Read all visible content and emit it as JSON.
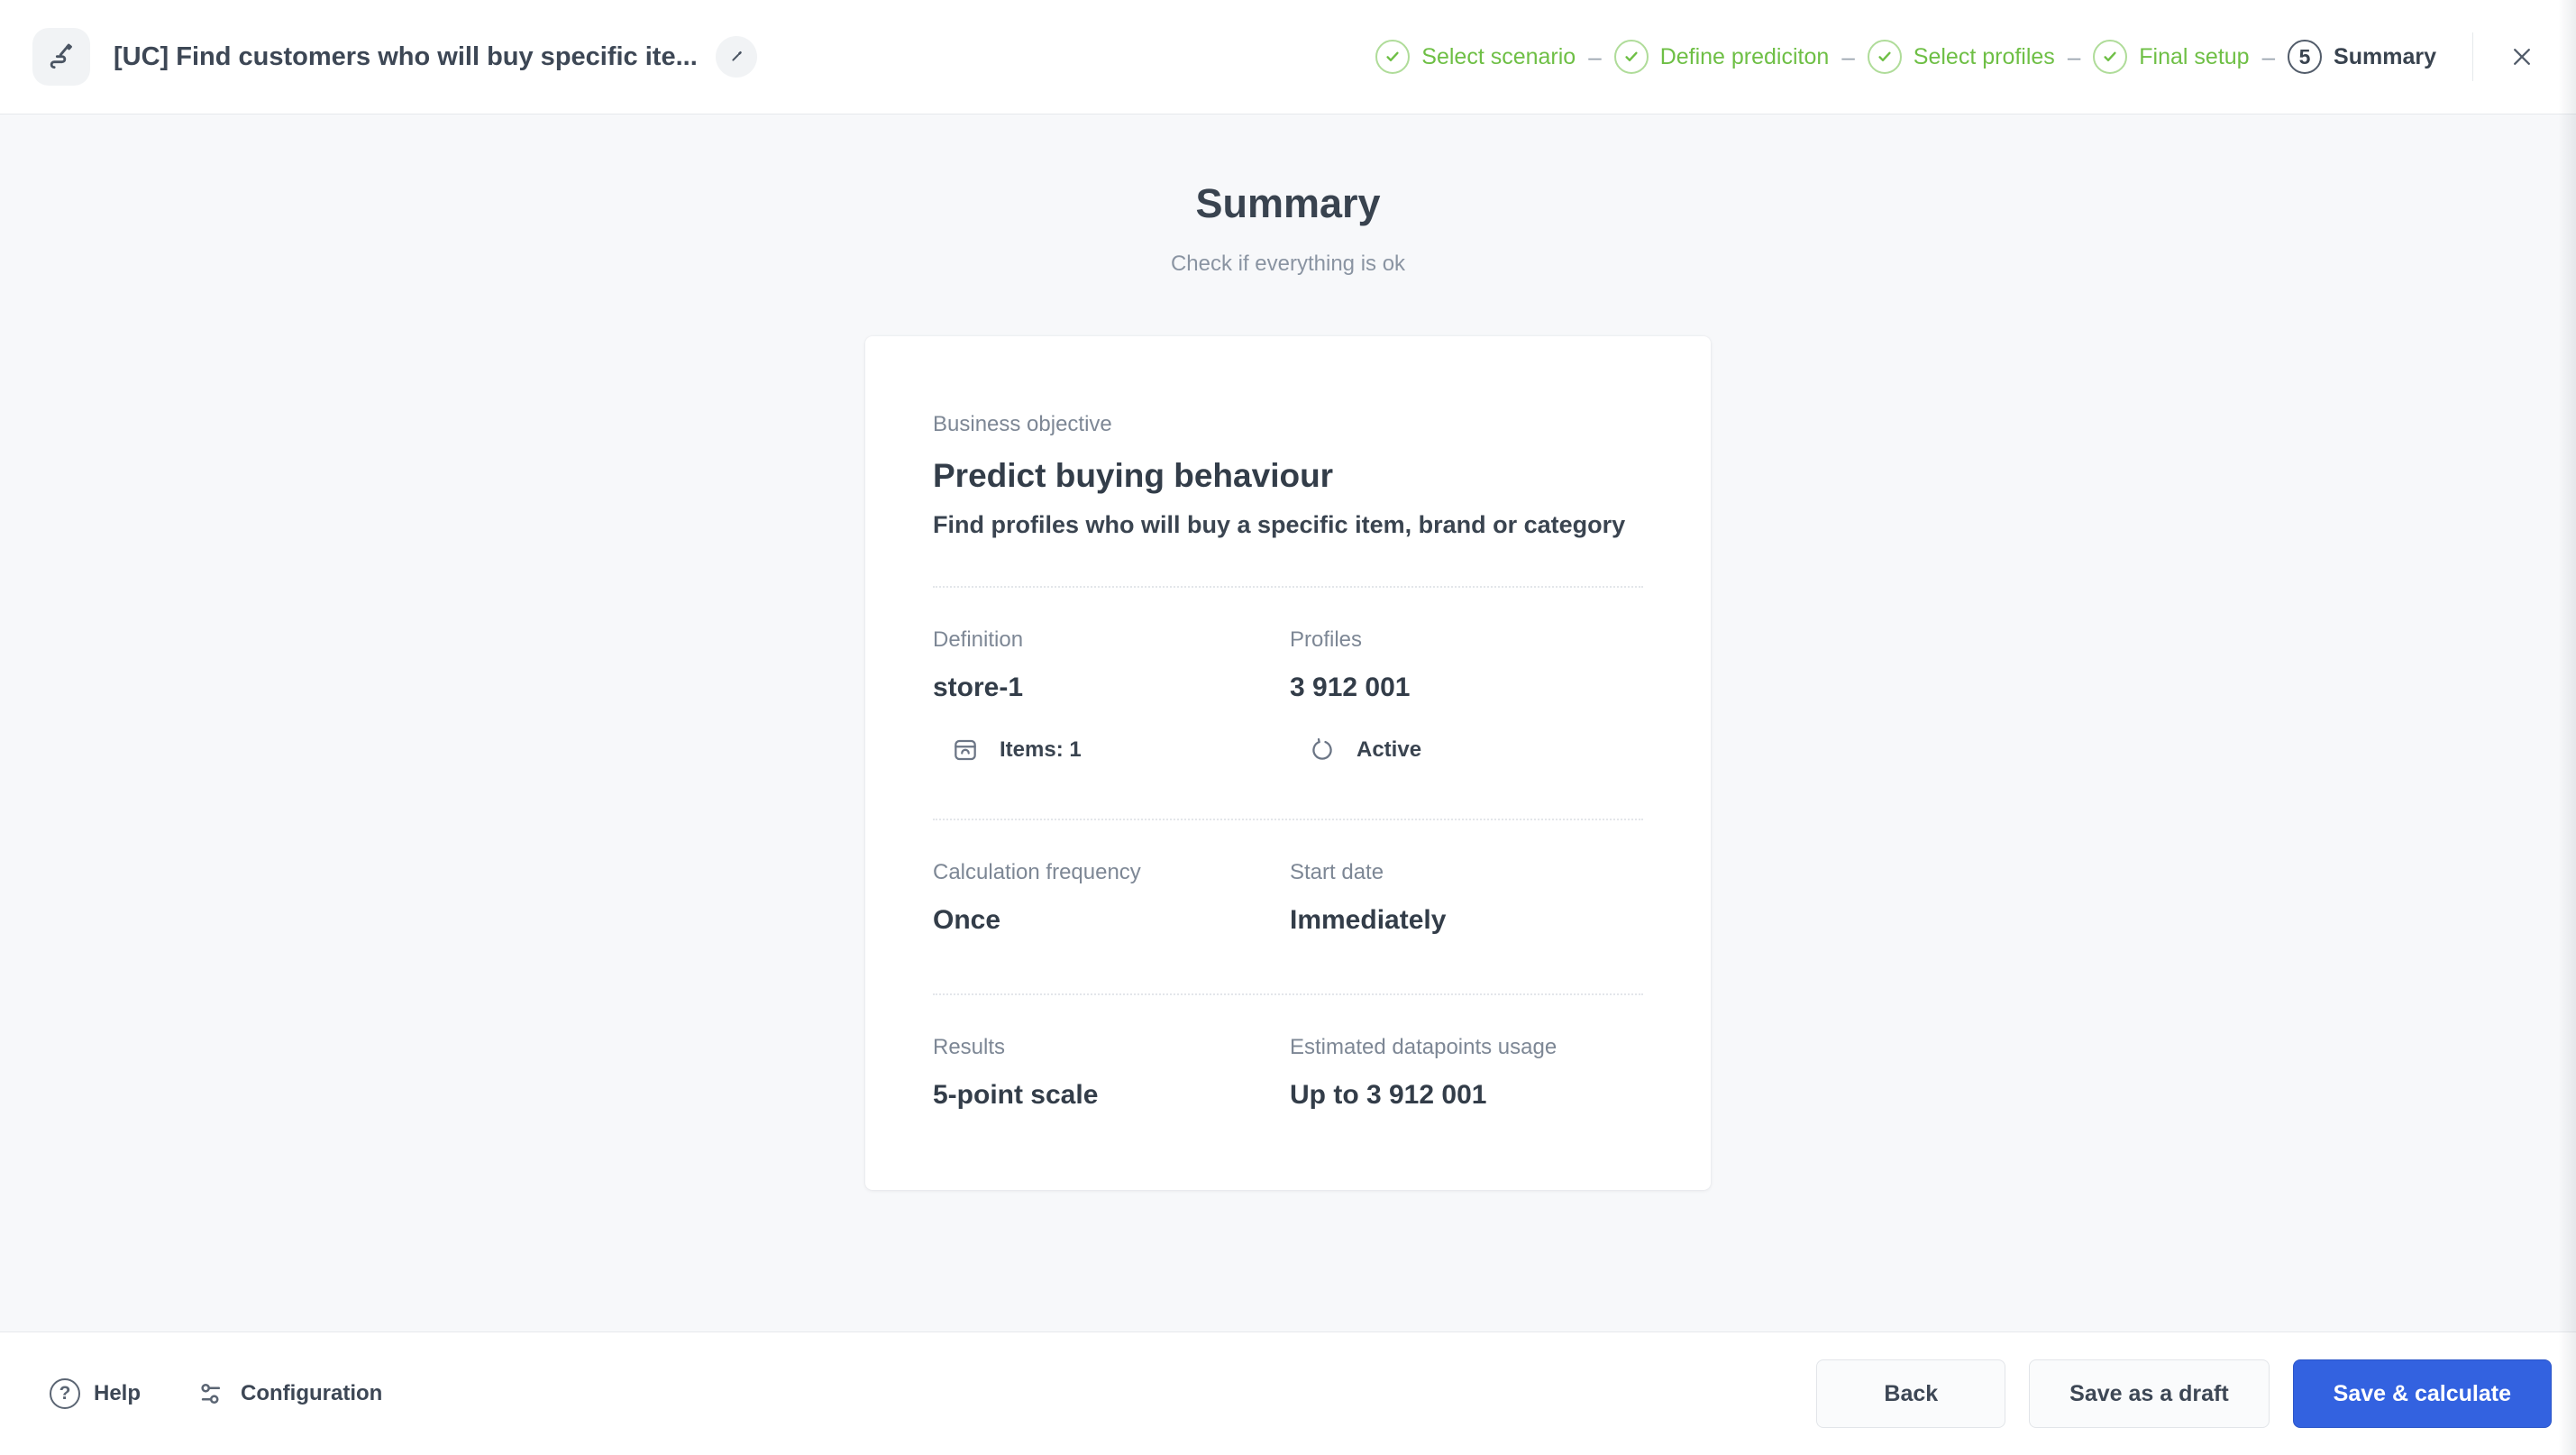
{
  "header": {
    "title": "[UC] Find customers who will buy specific ite...",
    "step_separator": "–",
    "steps": [
      {
        "label": "Select scenario",
        "state": "done"
      },
      {
        "label": "Define prediciton",
        "state": "done"
      },
      {
        "label": "Select profiles",
        "state": "done"
      },
      {
        "label": "Final setup",
        "state": "done"
      },
      {
        "label": "Summary",
        "state": "current",
        "number": "5"
      }
    ]
  },
  "main": {
    "title": "Summary",
    "subtitle": "Check if everything is ok",
    "card": {
      "objective": {
        "label": "Business objective",
        "value": "Predict buying behaviour",
        "description": "Find profiles who will buy a specific item, brand or category"
      },
      "definition": {
        "label": "Definition",
        "value": "store-1",
        "meta": "Items: 1"
      },
      "profiles": {
        "label": "Profiles",
        "value": "3 912 001",
        "meta": "Active"
      },
      "calculation_frequency": {
        "label": "Calculation frequency",
        "value": "Once"
      },
      "start_date": {
        "label": "Start date",
        "value": "Immediately"
      },
      "results": {
        "label": "Results",
        "value": "5-point scale"
      },
      "datapoints": {
        "label": "Estimated datapoints usage",
        "value": "Up to 3 912 001"
      }
    }
  },
  "footer": {
    "help": "Help",
    "configuration": "Configuration",
    "back": "Back",
    "save_draft": "Save as a draft",
    "save_calculate": "Save & calculate"
  },
  "icons": {
    "app": "flow-pencil-icon",
    "edit": "pencil-icon",
    "step_done": "check-circle-icon",
    "close": "close-icon",
    "items": "box-icon",
    "active": "sync-icon",
    "help_glyph": "?",
    "configuration": "sliders-icon"
  },
  "colors": {
    "accent_green": "#6ebf45",
    "primary_blue": "#3362e0",
    "text_dark": "#39434f",
    "text_gray": "#7d8795",
    "background": "#f7f8fa",
    "surface": "#ffffff",
    "border": "#e6e9ec"
  }
}
